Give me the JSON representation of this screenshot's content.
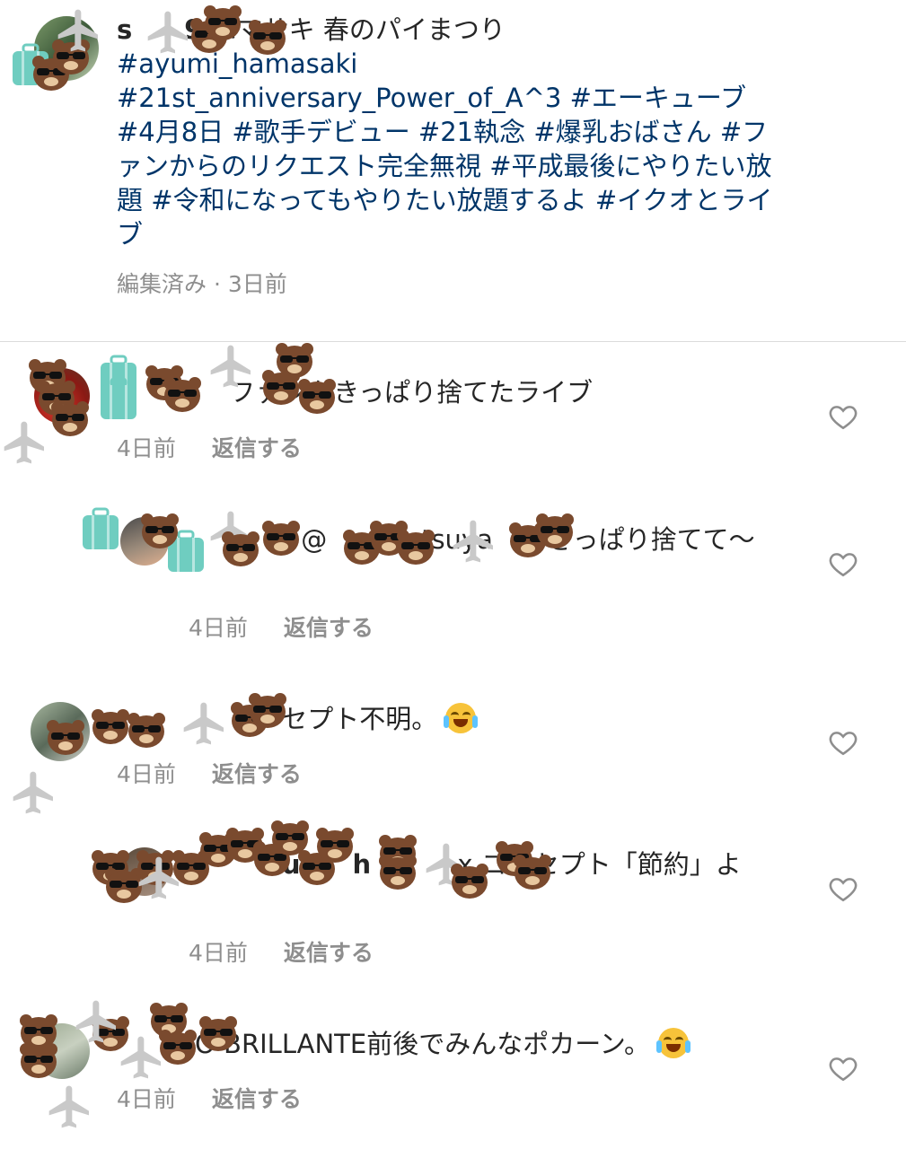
{
  "caption": {
    "username": "s　　9",
    "text": " ハマサキ 春のパイまつり",
    "hashtags": "#ayumi_hamasaki #21st_anniversary_Power_of_A^3 #エーキューブ #4月8日 #歌手デビュー #21執念 #爆乳おばさん #ファンからのリクエスト完全無視 #平成最後にやりたい放題 #令和になってもやりたい放題するよ #イクオとライブ",
    "meta": "編集済み · 3日前"
  },
  "comments": [
    {
      "username": "　　　　",
      "text": " ファンをきっぱり捨てたライブ",
      "time": "4日前",
      "reply_label": "返信する"
    },
    {
      "username": "　　　　",
      "text": " @　　　etsuya　tt きっぱり捨てて〜",
      "time": "4日前",
      "reply_label": "返信する"
    },
    {
      "username": "　　　　",
      "text": " コンセプト不明。",
      "emoji": "laughing-tears-emoji",
      "time": "4日前",
      "reply_label": "返信する"
    },
    {
      "username": "　　　zu　　h",
      "text": " @　　x コンセプト「節約」よ",
      "time": "4日前",
      "reply_label": "返信する"
    },
    {
      "username": "　　　",
      "text": "O BRILLANTE前後でみんなポカーン。",
      "emoji": "crying-emoji",
      "time": "4日前",
      "reply_label": "返信する"
    }
  ],
  "icons": {
    "like": "heart-outline-icon",
    "sticker_bear": "bear-sunglasses-sticker",
    "sticker_plane": "airplane-sticker",
    "sticker_suitcase": "suitcase-sticker"
  },
  "colors": {
    "hashtag": "#003569",
    "muted": "#8e8e8e",
    "text": "#262626",
    "divider": "#dbdbdb",
    "bear": "#7a4a2e",
    "suitcase": "#6fcdc0",
    "plane": "#c9c9c9"
  }
}
